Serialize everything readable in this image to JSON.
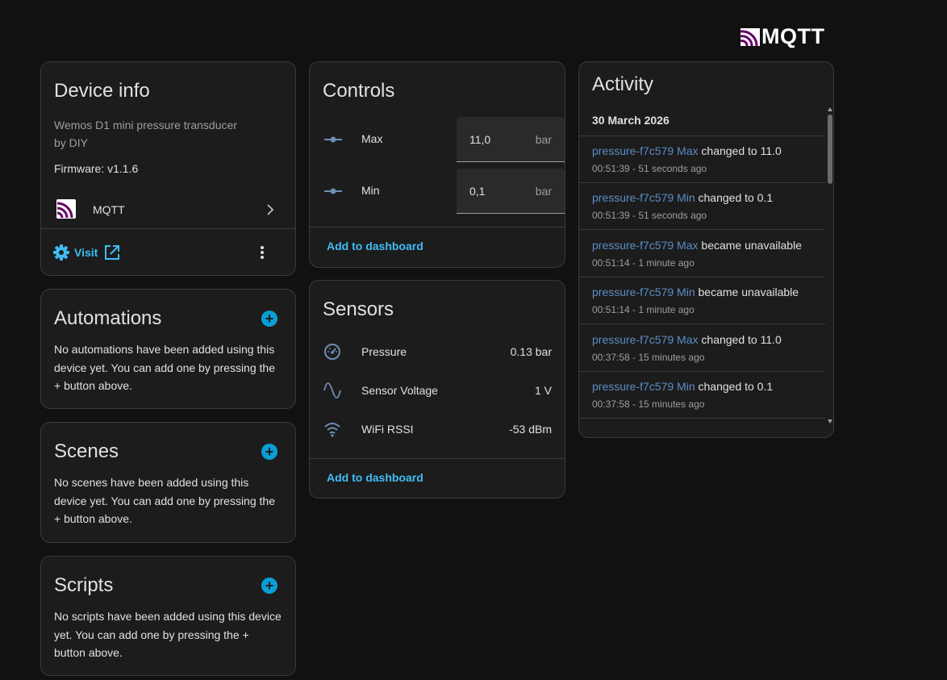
{
  "logo": {
    "text": "MQTT",
    "icon": "mqtt-icon"
  },
  "device_info": {
    "title": "Device info",
    "model": "Wemos D1 mini pressure transducer",
    "manufacturer": "by DIY",
    "firmware": "Firmware: v1.1.6",
    "integration_label": "MQTT",
    "visit_label": "Visit"
  },
  "automations": {
    "title": "Automations",
    "text": "No automations have been added using this device yet. You can add one by pressing the + button above."
  },
  "scenes": {
    "title": "Scenes",
    "text": "No scenes have been added using this device yet. You can add one by pressing the + button above."
  },
  "scripts": {
    "title": "Scripts",
    "text": "No scripts have been added using this device yet. You can add one by pressing the + button above."
  },
  "controls": {
    "title": "Controls",
    "items": [
      {
        "label": "Max",
        "value": "11,0",
        "unit": "bar",
        "icon": "slider-icon"
      },
      {
        "label": "Min",
        "value": "0,1",
        "unit": "bar",
        "icon": "slider-icon"
      }
    ],
    "add_label": "Add to dashboard"
  },
  "sensors": {
    "title": "Sensors",
    "items": [
      {
        "label": "Pressure",
        "value": "0.13 bar",
        "icon": "gauge-icon"
      },
      {
        "label": "Sensor Voltage",
        "value": "1 V",
        "icon": "sine-wave-icon"
      },
      {
        "label": "WiFi RSSI",
        "value": "-53 dBm",
        "icon": "wifi-icon"
      }
    ],
    "add_label": "Add to dashboard"
  },
  "activity": {
    "title": "Activity",
    "date": "30 March 2026",
    "entries": [
      {
        "entity": "pressure-f7c579 Max",
        "action": " changed to 11.0",
        "time": "00:51:39 - 51 seconds ago"
      },
      {
        "entity": "pressure-f7c579 Min",
        "action": " changed to 0.1",
        "time": "00:51:39 - 51 seconds ago"
      },
      {
        "entity": "pressure-f7c579 Max",
        "action": " became unavailable",
        "time": "00:51:14 - 1 minute ago"
      },
      {
        "entity": "pressure-f7c579 Min",
        "action": " became unavailable",
        "time": "00:51:14 - 1 minute ago"
      },
      {
        "entity": "pressure-f7c579 Max",
        "action": " changed to 11.0",
        "time": "00:37:58 - 15 minutes ago"
      },
      {
        "entity": "pressure-f7c579 Min",
        "action": " changed to 0.1",
        "time": "00:37:58 - 15 minutes ago"
      }
    ]
  },
  "colors": {
    "accent": "#41bdf5",
    "entity_link": "#5b8dc5",
    "plus_button": "#0b9ed6",
    "mqtt_purple": "#660066"
  }
}
